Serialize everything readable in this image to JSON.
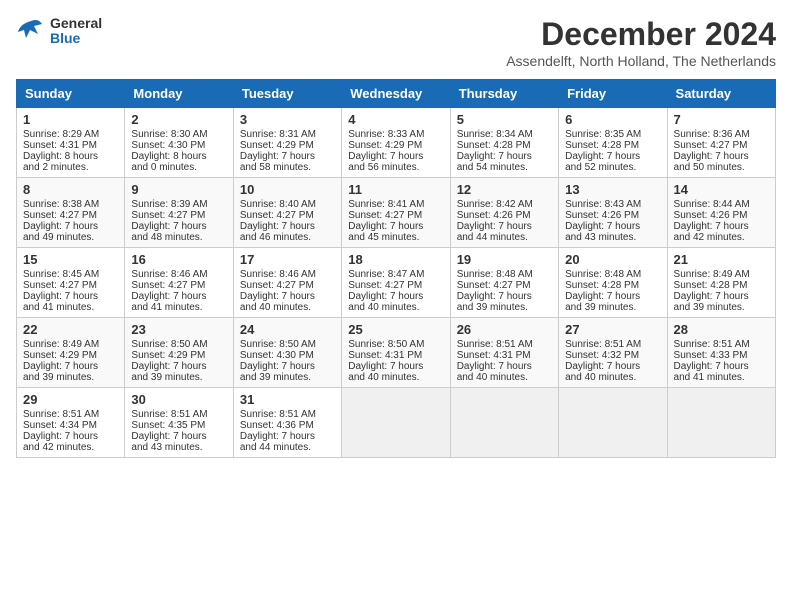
{
  "header": {
    "logo_line1": "General",
    "logo_line2": "Blue",
    "month_title": "December 2024",
    "subtitle": "Assendelft, North Holland, The Netherlands"
  },
  "days_of_week": [
    "Sunday",
    "Monday",
    "Tuesday",
    "Wednesday",
    "Thursday",
    "Friday",
    "Saturday"
  ],
  "weeks": [
    [
      {
        "day": "1",
        "sunrise": "8:29 AM",
        "sunset": "4:31 PM",
        "daylight": "8 hours and 2 minutes."
      },
      {
        "day": "2",
        "sunrise": "8:30 AM",
        "sunset": "4:30 PM",
        "daylight": "8 hours and 0 minutes."
      },
      {
        "day": "3",
        "sunrise": "8:31 AM",
        "sunset": "4:29 PM",
        "daylight": "7 hours and 58 minutes."
      },
      {
        "day": "4",
        "sunrise": "8:33 AM",
        "sunset": "4:29 PM",
        "daylight": "7 hours and 56 minutes."
      },
      {
        "day": "5",
        "sunrise": "8:34 AM",
        "sunset": "4:28 PM",
        "daylight": "7 hours and 54 minutes."
      },
      {
        "day": "6",
        "sunrise": "8:35 AM",
        "sunset": "4:28 PM",
        "daylight": "7 hours and 52 minutes."
      },
      {
        "day": "7",
        "sunrise": "8:36 AM",
        "sunset": "4:27 PM",
        "daylight": "7 hours and 50 minutes."
      }
    ],
    [
      {
        "day": "8",
        "sunrise": "8:38 AM",
        "sunset": "4:27 PM",
        "daylight": "7 hours and 49 minutes."
      },
      {
        "day": "9",
        "sunrise": "8:39 AM",
        "sunset": "4:27 PM",
        "daylight": "7 hours and 48 minutes."
      },
      {
        "day": "10",
        "sunrise": "8:40 AM",
        "sunset": "4:27 PM",
        "daylight": "7 hours and 46 minutes."
      },
      {
        "day": "11",
        "sunrise": "8:41 AM",
        "sunset": "4:27 PM",
        "daylight": "7 hours and 45 minutes."
      },
      {
        "day": "12",
        "sunrise": "8:42 AM",
        "sunset": "4:26 PM",
        "daylight": "7 hours and 44 minutes."
      },
      {
        "day": "13",
        "sunrise": "8:43 AM",
        "sunset": "4:26 PM",
        "daylight": "7 hours and 43 minutes."
      },
      {
        "day": "14",
        "sunrise": "8:44 AM",
        "sunset": "4:26 PM",
        "daylight": "7 hours and 42 minutes."
      }
    ],
    [
      {
        "day": "15",
        "sunrise": "8:45 AM",
        "sunset": "4:27 PM",
        "daylight": "7 hours and 41 minutes."
      },
      {
        "day": "16",
        "sunrise": "8:46 AM",
        "sunset": "4:27 PM",
        "daylight": "7 hours and 41 minutes."
      },
      {
        "day": "17",
        "sunrise": "8:46 AM",
        "sunset": "4:27 PM",
        "daylight": "7 hours and 40 minutes."
      },
      {
        "day": "18",
        "sunrise": "8:47 AM",
        "sunset": "4:27 PM",
        "daylight": "7 hours and 40 minutes."
      },
      {
        "day": "19",
        "sunrise": "8:48 AM",
        "sunset": "4:27 PM",
        "daylight": "7 hours and 39 minutes."
      },
      {
        "day": "20",
        "sunrise": "8:48 AM",
        "sunset": "4:28 PM",
        "daylight": "7 hours and 39 minutes."
      },
      {
        "day": "21",
        "sunrise": "8:49 AM",
        "sunset": "4:28 PM",
        "daylight": "7 hours and 39 minutes."
      }
    ],
    [
      {
        "day": "22",
        "sunrise": "8:49 AM",
        "sunset": "4:29 PM",
        "daylight": "7 hours and 39 minutes."
      },
      {
        "day": "23",
        "sunrise": "8:50 AM",
        "sunset": "4:29 PM",
        "daylight": "7 hours and 39 minutes."
      },
      {
        "day": "24",
        "sunrise": "8:50 AM",
        "sunset": "4:30 PM",
        "daylight": "7 hours and 39 minutes."
      },
      {
        "day": "25",
        "sunrise": "8:50 AM",
        "sunset": "4:31 PM",
        "daylight": "7 hours and 40 minutes."
      },
      {
        "day": "26",
        "sunrise": "8:51 AM",
        "sunset": "4:31 PM",
        "daylight": "7 hours and 40 minutes."
      },
      {
        "day": "27",
        "sunrise": "8:51 AM",
        "sunset": "4:32 PM",
        "daylight": "7 hours and 40 minutes."
      },
      {
        "day": "28",
        "sunrise": "8:51 AM",
        "sunset": "4:33 PM",
        "daylight": "7 hours and 41 minutes."
      }
    ],
    [
      {
        "day": "29",
        "sunrise": "8:51 AM",
        "sunset": "4:34 PM",
        "daylight": "7 hours and 42 minutes."
      },
      {
        "day": "30",
        "sunrise": "8:51 AM",
        "sunset": "4:35 PM",
        "daylight": "7 hours and 43 minutes."
      },
      {
        "day": "31",
        "sunrise": "8:51 AM",
        "sunset": "4:36 PM",
        "daylight": "7 hours and 44 minutes."
      },
      null,
      null,
      null,
      null
    ]
  ],
  "labels": {
    "sunrise": "Sunrise: ",
    "sunset": "Sunset: ",
    "daylight": "Daylight: "
  }
}
